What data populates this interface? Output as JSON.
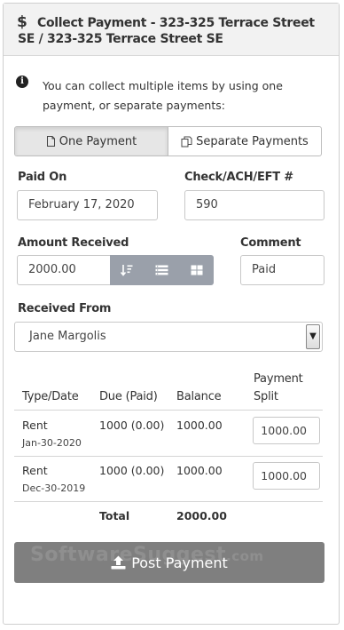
{
  "header": {
    "icon": "dollar-icon",
    "icon_glyph": "$",
    "title": "Collect Payment - 323-325 Terrace Street SE / 323-325 Terrace Street SE"
  },
  "info": {
    "icon": "info-icon",
    "text": "You can collect multiple items by using one payment, or separate payments:"
  },
  "payment_mode": {
    "options": [
      {
        "label": "One Payment",
        "icon": "file-icon",
        "selected": true
      },
      {
        "label": "Separate Payments",
        "icon": "copy-icon",
        "selected": false
      }
    ]
  },
  "form": {
    "paid_on_label": "Paid On",
    "paid_on_value": "February 17, 2020",
    "check_label": "Check/ACH/EFT #",
    "check_value": "590",
    "amount_label": "Amount Received",
    "amount_value": "2000.00",
    "amount_actions": [
      "sort-icon",
      "list-icon",
      "grid-icon"
    ],
    "comment_label": "Comment",
    "comment_value": "Paid",
    "received_from_label": "Received From",
    "received_from_value": "Jane Margolis"
  },
  "table": {
    "headers": [
      "Type/Date",
      "Due (Paid)",
      "Balance",
      "Payment",
      "Split"
    ],
    "rows": [
      {
        "type": "Rent",
        "date": "Jan-30-2020",
        "due": "1000 (0.00)",
        "balance": "1000.00",
        "split": "1000.00"
      },
      {
        "type": "Rent",
        "date": "Dec-30-2019",
        "due": "1000 (0.00)",
        "balance": "1000.00",
        "split": "1000.00"
      }
    ],
    "total_label": "Total",
    "total_value": "2000.00"
  },
  "post_button": {
    "label": "Post Payment",
    "icon": "upload-icon"
  },
  "watermark": {
    "main": "SoftwareSuggest",
    "suffix": ".com"
  },
  "colors": {
    "header_bg": "#f2f2f2",
    "button_group": "#9aa0aa",
    "post_button": "#7f7f7f"
  }
}
